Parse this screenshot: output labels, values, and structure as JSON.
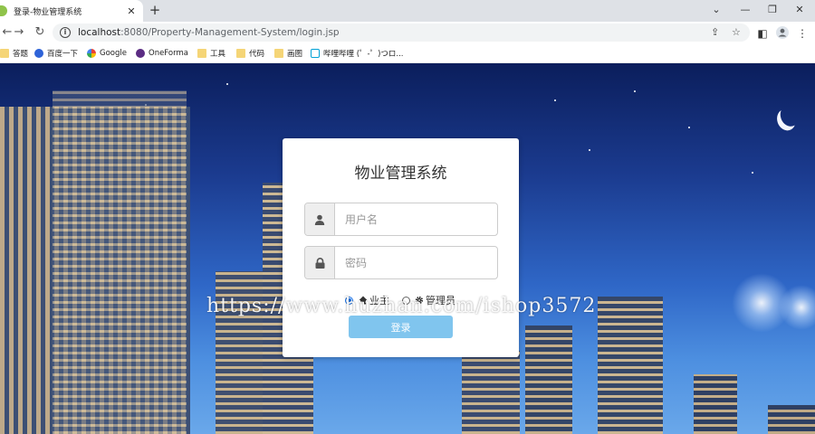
{
  "browser": {
    "tab_title": "登录-物业管理系统",
    "tab_close": "✕",
    "new_tab": "+",
    "window_controls": {
      "collapse": "⌄",
      "minimize": "—",
      "maximize": "❐",
      "close": "✕"
    },
    "url_host": "localhost",
    "url_rest": ":8080/Property-Management-System/login.jsp",
    "bookmarks": [
      {
        "label": "答题",
        "icon": "folder-icon"
      },
      {
        "label": "百度一下",
        "icon": "baidu-icon"
      },
      {
        "label": "Google",
        "icon": "google-icon"
      },
      {
        "label": "OneForma",
        "icon": "oneforma-icon"
      },
      {
        "label": "工具",
        "icon": "folder-icon"
      },
      {
        "label": "代码",
        "icon": "folder-icon"
      },
      {
        "label": "画图",
        "icon": "folder-icon"
      },
      {
        "label": "哔哩哔哩 (゜-゜)つロ...",
        "icon": "bilibili-icon"
      }
    ]
  },
  "login": {
    "title": "物业管理系统",
    "username_placeholder": "用户名",
    "password_placeholder": "密码",
    "roles": [
      {
        "label": "业主",
        "selected": true,
        "icon": "home-icon"
      },
      {
        "label": "管理员",
        "selected": false,
        "icon": "gear-icon"
      }
    ],
    "submit_label": "登录"
  },
  "watermark": "https://www.huzhan.com/ishop3572",
  "colors": {
    "button": "#80c5ee",
    "radio_selected": "#1a73e8",
    "sky_top": "#0b1e5c",
    "sky_bottom": "#6aa8ea"
  }
}
